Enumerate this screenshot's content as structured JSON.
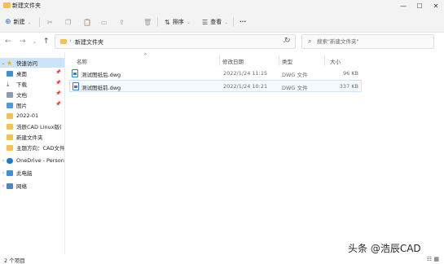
{
  "window": {
    "title": "新建文件夹",
    "controls": [
      "—",
      "☐",
      "✕"
    ]
  },
  "toolbar": {
    "new_label": "新建",
    "sort_label": "排序",
    "view_label": "查看",
    "more_label": "···"
  },
  "nav": {
    "back": "←",
    "forward": "→",
    "up": "↑",
    "address": "新建文件夹",
    "refresh": "↻"
  },
  "search": {
    "placeholder": "搜索\"新建文件夹\""
  },
  "sidebar": {
    "items": [
      {
        "label": "快速访问",
        "icon": "star-icon"
      },
      {
        "label": "桌面",
        "icon": "desktop-icon",
        "pinned": true
      },
      {
        "label": "下载",
        "icon": "download-icon",
        "pinned": true
      },
      {
        "label": "文档",
        "icon": "document-icon",
        "pinned": true
      },
      {
        "label": "图片",
        "icon": "picture-icon",
        "pinned": true
      },
      {
        "label": "2022-01",
        "icon": "folder-icon"
      },
      {
        "label": "浩辰CAD Linux版(",
        "icon": "folder-icon"
      },
      {
        "label": "新建文件夹",
        "icon": "folder-icon"
      },
      {
        "label": "主题方向：CAD文件",
        "icon": "folder-icon"
      },
      {
        "label": "OneDrive - Persona",
        "icon": "cloud-icon"
      },
      {
        "label": "此电脑",
        "icon": "computer-icon"
      },
      {
        "label": "网络",
        "icon": "network-icon"
      }
    ]
  },
  "columns": {
    "name": "名称",
    "modified": "修改日期",
    "type": "类型",
    "size": "大小"
  },
  "files": [
    {
      "name": "测试图纸后.dwg",
      "modified": "2022/1/24 11:15",
      "type": "DWG 文件",
      "size": "96 KB"
    },
    {
      "name": "测试图纸前.dwg",
      "modified": "2022/1/24 10:21",
      "type": "DWG 文件",
      "size": "337 KB"
    }
  ],
  "status": {
    "count": "2 个项目"
  },
  "watermark": "头条 @浩辰CAD",
  "colors": {
    "folder": "#f4c24d",
    "selection": "#cce4f7",
    "accent": "#3b7bd6"
  }
}
